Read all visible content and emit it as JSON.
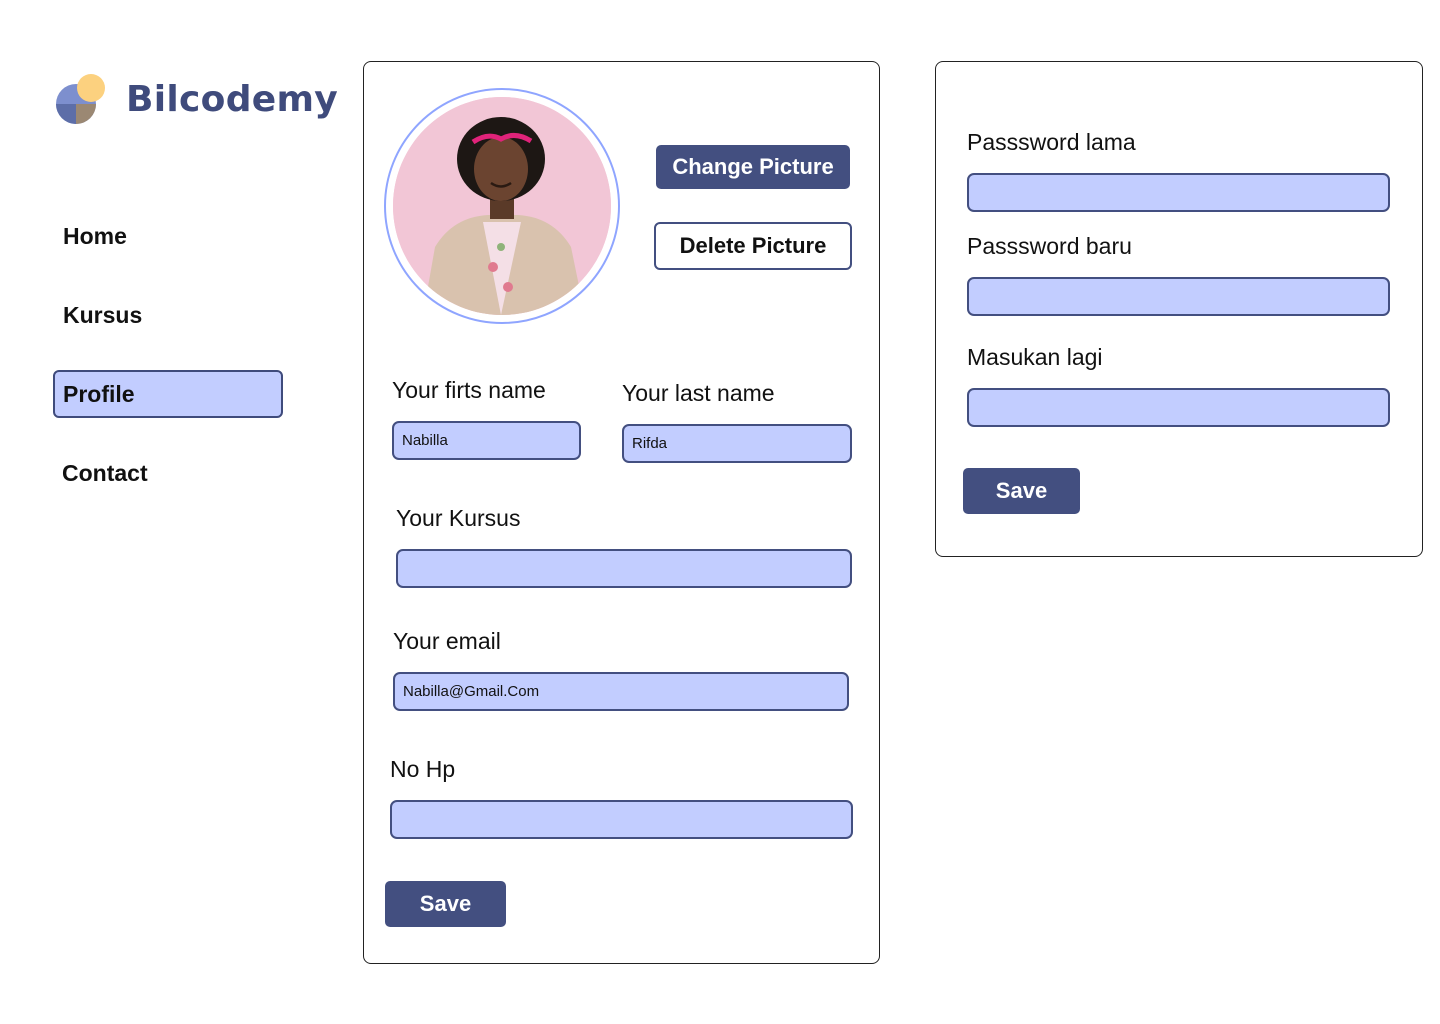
{
  "brand": {
    "name": "Bilcodemy"
  },
  "nav": {
    "items": [
      {
        "label": "Home"
      },
      {
        "label": "Kursus"
      },
      {
        "label": "Profile",
        "active": true
      },
      {
        "label": "Contact"
      }
    ]
  },
  "profile": {
    "change_picture_label": "Change Picture",
    "delete_picture_label": "Delete Picture",
    "first_name_label": "Your firts name",
    "first_name_value": "Nabilla",
    "last_name_label": "Your last name",
    "last_name_value": "Rifda",
    "kursus_label": "Your Kursus",
    "kursus_value": "",
    "email_label": "Your email",
    "email_value": "Nabilla@Gmail.Com",
    "phone_label": "No Hp",
    "phone_value": "",
    "save_label": "Save"
  },
  "password": {
    "old_label": "Passsword  lama",
    "new_label": "Passsword  baru",
    "confirm_label": "Masukan lagi",
    "save_label": "Save"
  },
  "colors": {
    "accent": "#434f80",
    "field_bg": "#c2cdff",
    "avatar_ring": "#8fa5ff",
    "logo_yellow": "#fcd17f",
    "logo_blue": "#7d8fce",
    "logo_brown": "#9b8873"
  },
  "icons": {
    "logo": "bilcodemy-logo-icon"
  }
}
